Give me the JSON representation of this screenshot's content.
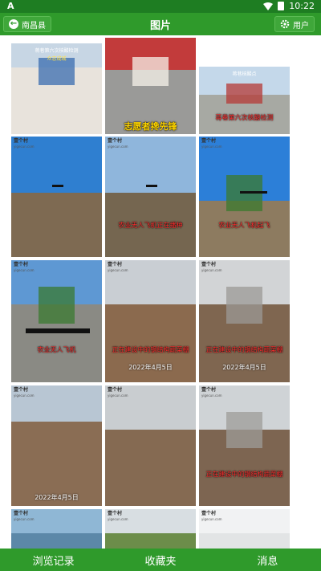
{
  "status_bar": {
    "left_glyph": "A",
    "time": "10:22",
    "icons": [
      "wifi-icon",
      "battery-icon"
    ]
  },
  "app_bar": {
    "back_label": "南昌县",
    "title": "图片",
    "user_label": "用户",
    "back_icon": "back-arrow-icon",
    "user_icon": "gear-icon"
  },
  "gallery": {
    "watermark": "壹个村",
    "watermark_sub": "yigecun.com",
    "tiles": [
      {
        "caption": "",
        "date": "",
        "banner": "蒋巷第六次核酸检测",
        "banner2": "众志成城",
        "scene": "nucleic-test"
      },
      {
        "caption": "志愿者搀先锋",
        "date": "",
        "banner": "",
        "scene": "volunteers"
      },
      {
        "caption": "蒋巷第六次核酸检测",
        "date": "",
        "banner": "蒋巷核酸点",
        "scene": "test-site"
      },
      {
        "caption": "",
        "date": "",
        "banner": "",
        "scene": "field-drone-far"
      },
      {
        "caption": "农业无人飞机正在播种",
        "date": "",
        "banner": "",
        "scene": "field-drone"
      },
      {
        "caption": "农业无人飞机起飞",
        "date": "",
        "banner": "",
        "scene": "drone-takeoff"
      },
      {
        "caption": "农业无人飞机",
        "date": "",
        "banner": "",
        "scene": "drone-ground"
      },
      {
        "caption": "正在建设中的钢结构蔬菜棚",
        "date": "2022年4月5日",
        "banner": "",
        "scene": "construction"
      },
      {
        "caption": "正在建设中的钢结构蔬菜棚",
        "date": "2022年4月5日",
        "banner": "",
        "scene": "steel-frame"
      },
      {
        "caption": "",
        "date": "2022年4月5日",
        "banner": "",
        "scene": "construction-2"
      },
      {
        "caption": "",
        "date": "",
        "banner": "",
        "scene": "construction-3"
      },
      {
        "caption": "正在建设中的钢结构蔬菜棚",
        "date": "",
        "banner": "",
        "scene": "steel-frame-2"
      },
      {
        "caption": "",
        "date": "",
        "banner": "",
        "scene": "lake"
      },
      {
        "caption": "",
        "date": "",
        "banner": "",
        "scene": "green-field"
      },
      {
        "caption": "",
        "date": "",
        "banner": "",
        "scene": "blank"
      }
    ]
  },
  "bottom_nav": {
    "items": [
      "浏览记录",
      "收藏夹",
      "消息"
    ]
  }
}
